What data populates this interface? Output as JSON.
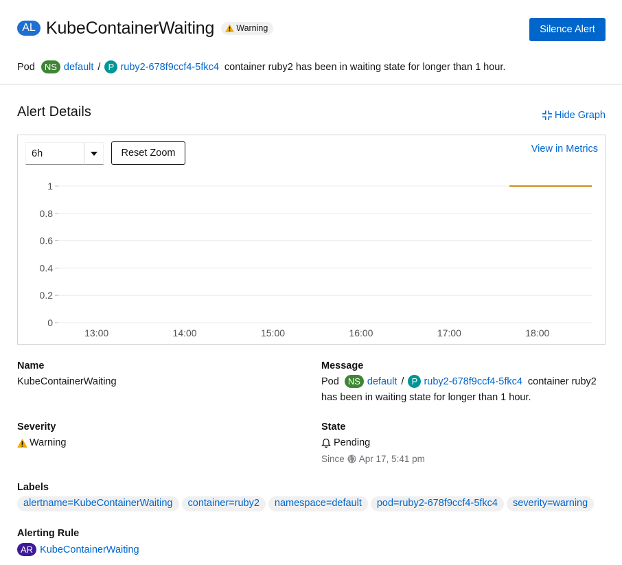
{
  "header": {
    "kind_badge": "AL",
    "title": "KubeContainerWaiting",
    "severity_label": "Warning",
    "silence_button": "Silence Alert"
  },
  "description": {
    "kind": "Pod",
    "ns_badge": "NS",
    "namespace": "default",
    "separator": "/",
    "pod_badge": "P",
    "pod": "ruby2-678f9ccf4-5fkc4",
    "text": "container ruby2 has been in waiting state for longer than 1 hour."
  },
  "details": {
    "title": "Alert Details",
    "hide_graph": "Hide Graph"
  },
  "graph": {
    "range_selected": "6h",
    "reset_zoom": "Reset Zoom",
    "view_in_metrics": "View in Metrics",
    "series_color": "#d08c1a"
  },
  "chart_data": {
    "type": "line",
    "x_ticks": [
      "13:00",
      "14:00",
      "15:00",
      "16:00",
      "17:00",
      "18:00"
    ],
    "y_ticks": [
      "0",
      "0.2",
      "0.4",
      "0.6",
      "0.8",
      "1"
    ],
    "ylim": [
      0,
      1
    ],
    "xlim": [
      "12:34",
      "18:37"
    ],
    "grid": true,
    "series": [
      {
        "x": [
          "17:41",
          "18:37"
        ],
        "values": [
          1,
          1
        ]
      }
    ]
  },
  "fields": {
    "name_label": "Name",
    "name_value": "KubeContainerWaiting",
    "message_label": "Message",
    "message": {
      "kind": "Pod",
      "ns_badge": "NS",
      "namespace": "default",
      "separator": "/",
      "pod_badge": "P",
      "pod": "ruby2-678f9ccf4-5fkc4",
      "text_line1": "container ruby2",
      "text_line2": "has been in waiting state for longer than 1 hour."
    },
    "severity_label": "Severity",
    "severity_value": "Warning",
    "state_label": "State",
    "state_value": "Pending",
    "since_prefix": "Since",
    "since_value": "Apr 17, 5:41 pm",
    "labels_label": "Labels",
    "labels": [
      "alertname=KubeContainerWaiting",
      "container=ruby2",
      "namespace=default",
      "pod=ruby2-678f9ccf4-5fkc4",
      "severity=warning"
    ],
    "rule_label": "Alerting Rule",
    "rule_badge": "AR",
    "rule_value": "KubeContainerWaiting"
  }
}
